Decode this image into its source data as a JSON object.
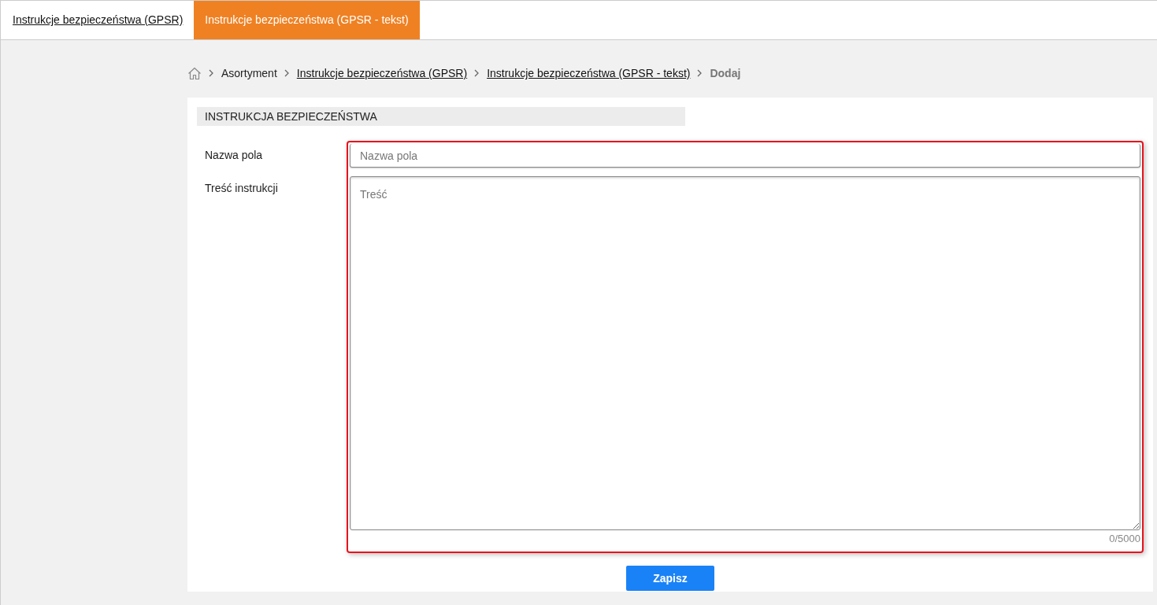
{
  "tabs": [
    {
      "label": "Instrukcje bezpieczeństwa (GPSR)",
      "selected": false
    },
    {
      "label": "Instrukcje bezpieczeństwa (GPSR - tekst)",
      "selected": true
    }
  ],
  "breadcrumb": [
    {
      "kind": "home"
    },
    {
      "kind": "text",
      "label": "Asortyment"
    },
    {
      "kind": "link",
      "label": "Instrukcje bezpieczeństwa (GPSR)"
    },
    {
      "kind": "link",
      "label": "Instrukcje bezpieczeństwa (GPSR - tekst)"
    },
    {
      "kind": "current",
      "label": "Dodaj"
    }
  ],
  "section": {
    "title": "INSTRUKCJA BEZPIECZEŃSTWA"
  },
  "form": {
    "highlighted": true,
    "fields": [
      {
        "kind": "input",
        "label": "Nazwa pola",
        "placeholder": "Nazwa pola"
      },
      {
        "kind": "textarea",
        "label": "Treść instrukcji",
        "placeholder": "Treść",
        "counter": "0/5000"
      }
    ]
  },
  "submit": {
    "label": "Zapisz"
  }
}
